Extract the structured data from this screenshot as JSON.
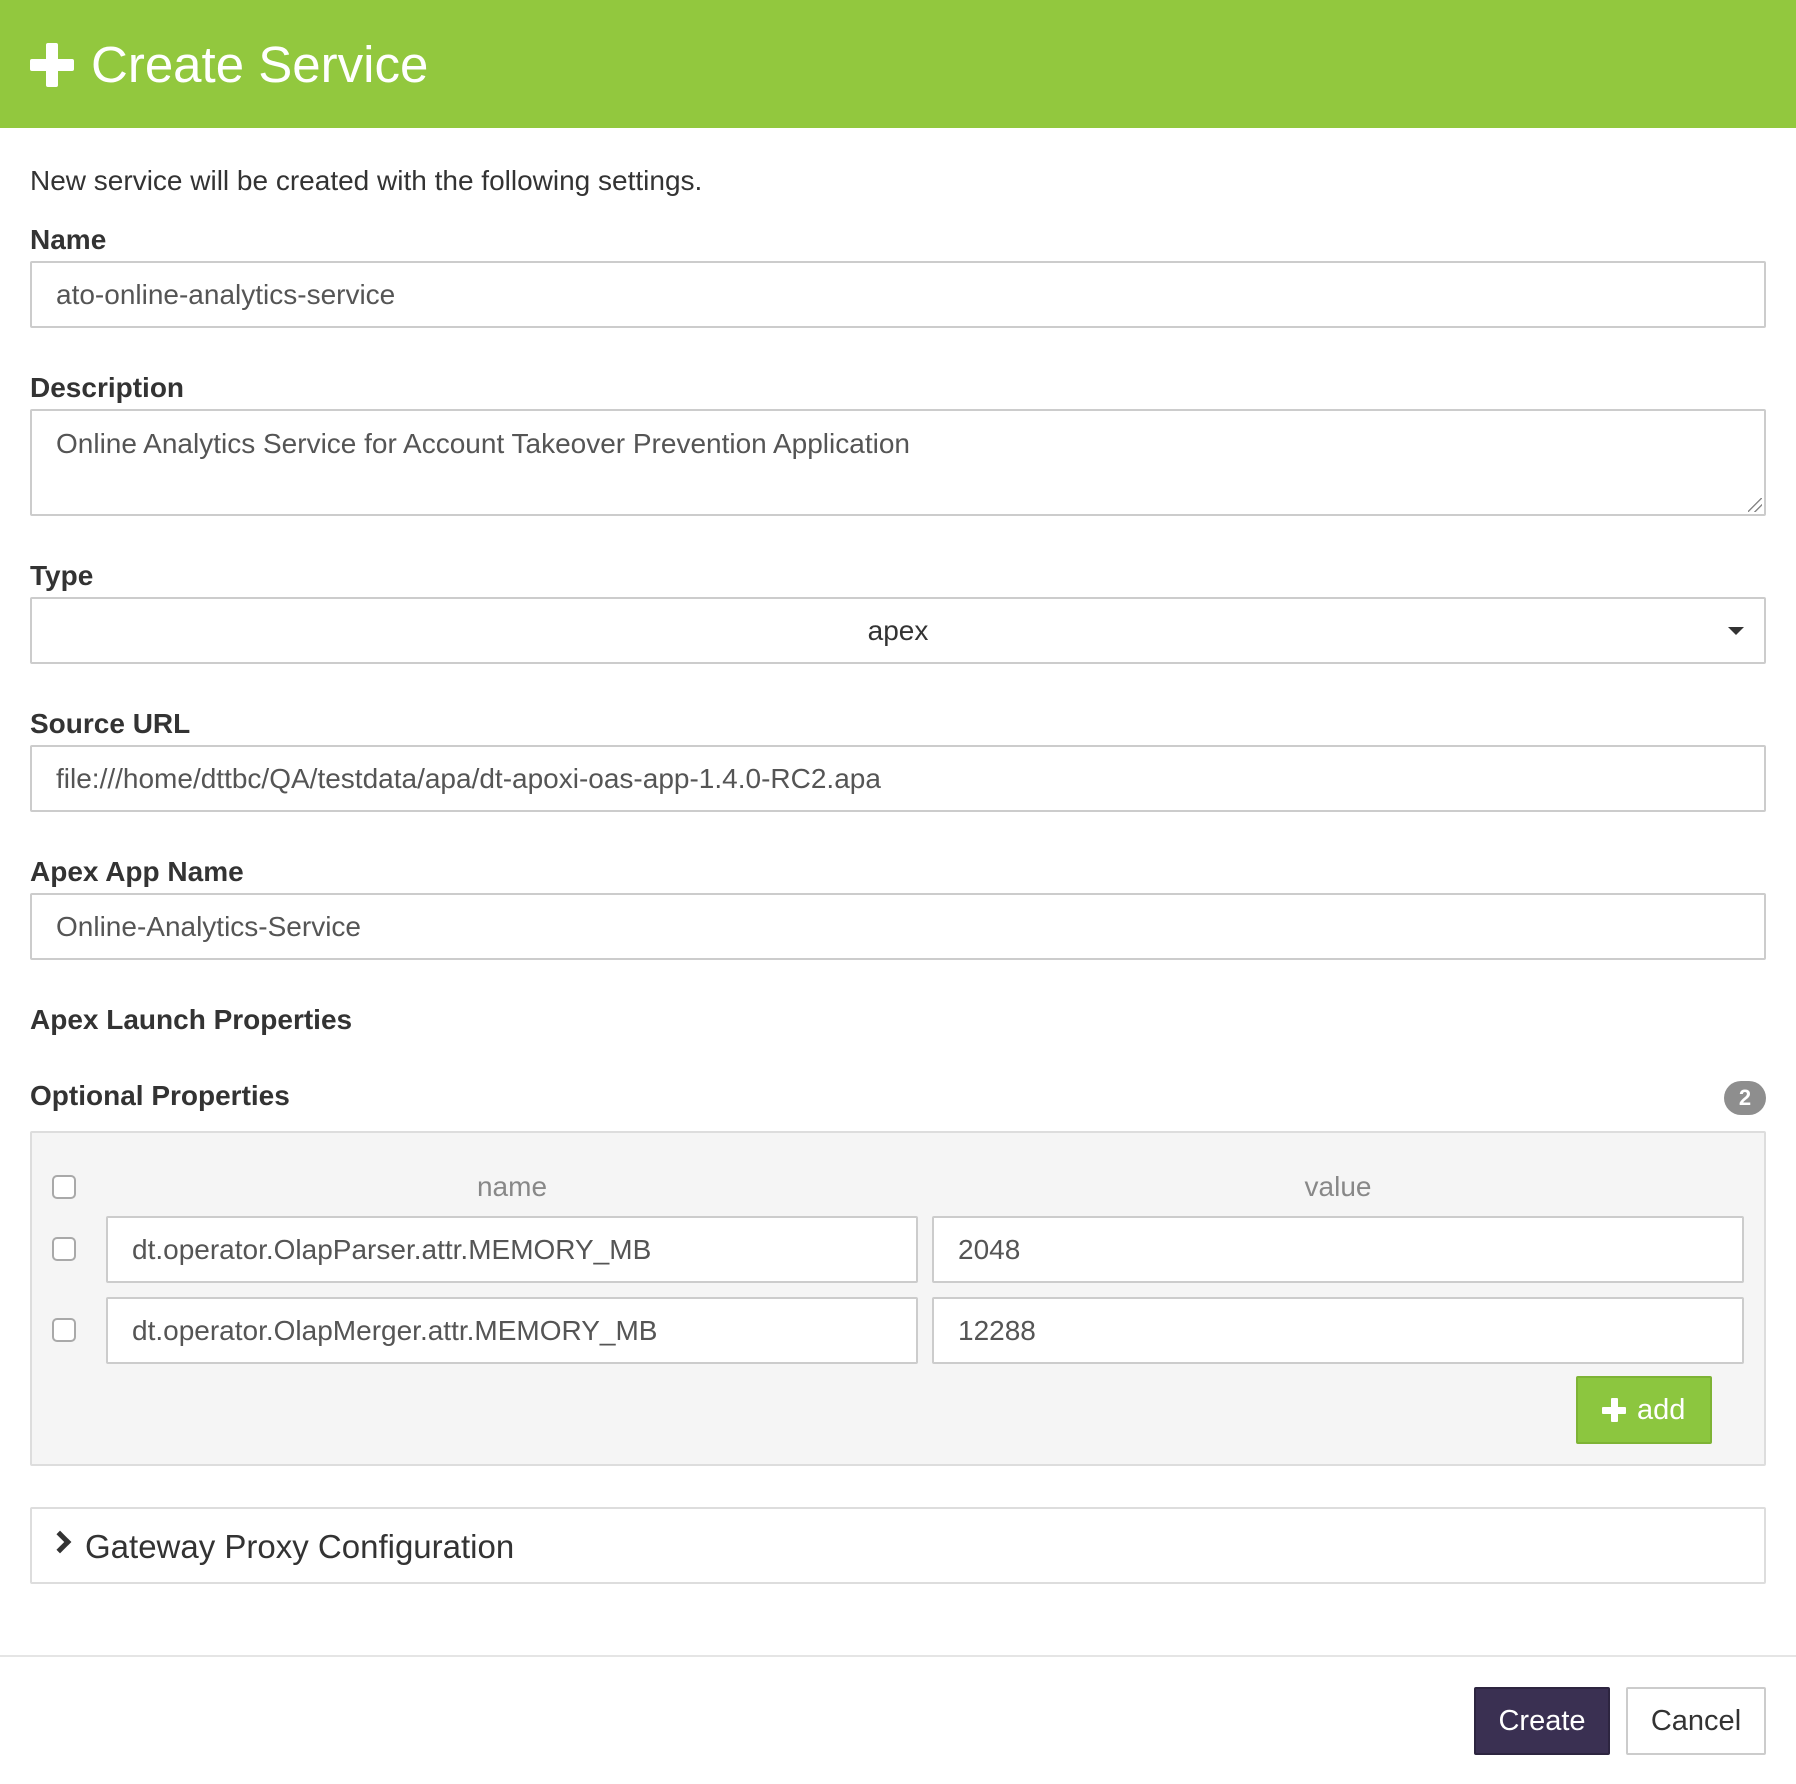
{
  "header": {
    "title": "Create Service",
    "color": "#92c83e"
  },
  "intro": "New service will be created with the following settings.",
  "form": {
    "name": {
      "label": "Name",
      "value": "ato-online-analytics-service"
    },
    "description": {
      "label": "Description",
      "value": "Online Analytics Service for Account Takeover Prevention Application"
    },
    "type": {
      "label": "Type",
      "value": "apex"
    },
    "source_url": {
      "label": "Source URL",
      "value": "file:///home/dttbc/QA/testdata/apa/dt-apoxi-oas-app-1.4.0-RC2.apa"
    },
    "apex_app_name": {
      "label": "Apex App Name",
      "value": "Online-Analytics-Service"
    },
    "apex_launch_properties": {
      "label": "Apex Launch Properties"
    }
  },
  "optional_properties": {
    "label": "Optional Properties",
    "count": "2",
    "columns": {
      "name": "name",
      "value": "value"
    },
    "rows": [
      {
        "name": "dt.operator.OlapParser.attr.MEMORY_MB",
        "value": "2048"
      },
      {
        "name": "dt.operator.OlapMerger.attr.MEMORY_MB",
        "value": "12288"
      }
    ],
    "add_label": "add",
    "add_color": "#8cc63f"
  },
  "gateway": {
    "label": "Gateway Proxy Configuration"
  },
  "footer": {
    "create_label": "Create",
    "cancel_label": "Cancel",
    "create_color": "#3a3052"
  }
}
